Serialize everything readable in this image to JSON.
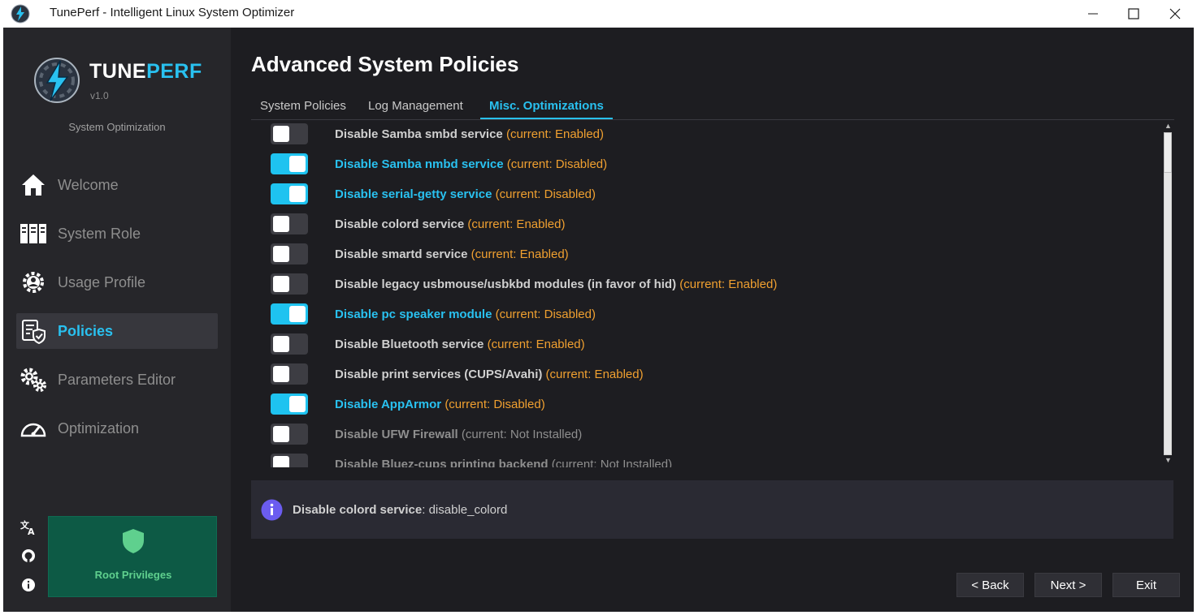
{
  "window": {
    "title": "TunePerf - Intelligent Linux System Optimizer"
  },
  "brand": {
    "name_part1": "TUNE",
    "name_part2": "PERF",
    "version": "v1.0",
    "subtitle": "System Optimization",
    "accent_color": "#29c1f0"
  },
  "sidebar": {
    "items": [
      {
        "label": "Welcome",
        "icon": "home-icon",
        "active": false
      },
      {
        "label": "System Role",
        "icon": "server-icon",
        "active": false
      },
      {
        "label": "Usage Profile",
        "icon": "gear-person-icon",
        "active": false
      },
      {
        "label": "Policies",
        "icon": "policy-shield-icon",
        "active": true
      },
      {
        "label": "Parameters Editor",
        "icon": "gears-icon",
        "active": false
      },
      {
        "label": "Optimization",
        "icon": "gauge-icon",
        "active": false
      }
    ],
    "utility_icons": [
      "translate-icon",
      "github-icon",
      "info-icon"
    ],
    "root_status": {
      "label": "Root Privileges",
      "color": "#0d5a45"
    }
  },
  "main": {
    "title": "Advanced System Policies",
    "tabs": [
      {
        "label": "System Policies",
        "active": false
      },
      {
        "label": "Log Management",
        "active": false
      },
      {
        "label": "Misc. Optimizations",
        "active": true
      }
    ],
    "policies": [
      {
        "name": "Disable Samba smbd service",
        "status": "(current: Enabled)",
        "enabled": false,
        "dim": false
      },
      {
        "name": "Disable Samba nmbd service",
        "status": "(current: Disabled)",
        "enabled": true,
        "dim": false
      },
      {
        "name": "Disable serial-getty service",
        "status": "(current: Disabled)",
        "enabled": true,
        "dim": false
      },
      {
        "name": "Disable colord service",
        "status": "(current: Enabled)",
        "enabled": false,
        "dim": false
      },
      {
        "name": "Disable smartd service",
        "status": "(current: Enabled)",
        "enabled": false,
        "dim": false
      },
      {
        "name": "Disable legacy usbmouse/usbkbd modules (in favor of hid)",
        "status": "(current: Enabled)",
        "enabled": false,
        "dim": false
      },
      {
        "name": "Disable pc speaker module",
        "status": "(current: Disabled)",
        "enabled": true,
        "dim": false
      },
      {
        "name": "Disable Bluetooth service",
        "status": "(current: Enabled)",
        "enabled": false,
        "dim": false
      },
      {
        "name": "Disable print services (CUPS/Avahi)",
        "status": "(current: Enabled)",
        "enabled": false,
        "dim": false
      },
      {
        "name": "Disable AppArmor",
        "status": "(current: Disabled)",
        "enabled": true,
        "dim": false
      },
      {
        "name": "Disable UFW Firewall",
        "status": "(current: Not Installed)",
        "enabled": false,
        "dim": true
      },
      {
        "name": "Disable Bluez-cups printing backend",
        "status": "(current: Not Installed)",
        "enabled": false,
        "dim": true
      }
    ],
    "info": {
      "name": "Disable colord service",
      "separator": ":",
      "value": " disable_colord"
    },
    "buttons": {
      "back": "< Back",
      "next": "Next >",
      "exit": "Exit"
    }
  },
  "colors": {
    "toggle_on": "#1ec3f0",
    "status_orange": "#f0a030",
    "dim_text": "#8e8e8e"
  }
}
